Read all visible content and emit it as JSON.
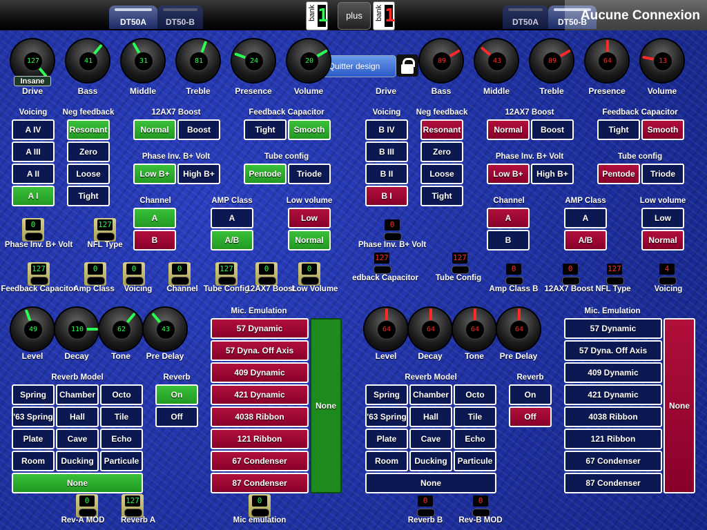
{
  "topbar": {
    "tab_a_left": "DT50A",
    "tab_b_left": "DT50-B",
    "bank_label": "bank",
    "bank_a": "1",
    "plus": "plus",
    "bank_b": "1",
    "tab_a_right": "DT50A",
    "tab_b_right": "DT50-B",
    "status": "Aucune Connexion"
  },
  "design": {
    "quit": "Quitter design"
  },
  "colors": {
    "green": "#34b934",
    "red": "#a8103a",
    "navy": "#0c1852",
    "digit_green": "#2aff55",
    "digit_red": "#ff2a2a"
  },
  "left": {
    "knobs": [
      {
        "label": "Drive",
        "value": "127"
      },
      {
        "label": "Bass",
        "value": "41"
      },
      {
        "label": "Middle",
        "value": "31"
      },
      {
        "label": "Treble",
        "value": "81"
      },
      {
        "label": "Presence",
        "value": "24"
      },
      {
        "label": "Volume",
        "value": "20"
      }
    ],
    "insane": "Insane",
    "voicing": {
      "header": "Voicing",
      "items": [
        "A IV",
        "A III",
        "A II",
        "A I"
      ]
    },
    "negfb": {
      "header": "Neg feedback",
      "items": [
        "Resonant",
        "Zero",
        "Loose",
        "Tight"
      ]
    },
    "boost": {
      "header": "12AX7 Boost",
      "items": [
        "Normal",
        "Boost"
      ]
    },
    "fbcap": {
      "header": "Feedback Capacitor",
      "items": [
        "Tight",
        "Smooth"
      ]
    },
    "phase": {
      "header": "Phase Inv. B+ Volt",
      "items": [
        "Low B+",
        "High B+"
      ]
    },
    "tube": {
      "header": "Tube config",
      "items": [
        "Pentode",
        "Triode"
      ]
    },
    "channel": {
      "header": "Channel",
      "items": [
        "A",
        "B"
      ]
    },
    "ampclass": {
      "header": "AMP Class",
      "items": [
        "A",
        "A/B"
      ]
    },
    "lowvol": {
      "header": "Low volume",
      "items": [
        "Low",
        "Normal"
      ]
    },
    "selectors1": [
      {
        "label": "Phase Inv. B+ Volt",
        "value": "0"
      },
      {
        "label": "NFL Type",
        "value": "127"
      }
    ],
    "selectors2": [
      {
        "label": "Feedback Capacitor",
        "value": "127"
      },
      {
        "label": "Amp Class",
        "value": "0"
      },
      {
        "label": "Voicing",
        "value": "0"
      },
      {
        "label": "Channel",
        "value": "0"
      },
      {
        "label": "Tube Config",
        "value": "127"
      },
      {
        "label": "12AX7 Boost",
        "value": "0"
      },
      {
        "label": "Low Volume",
        "value": "0"
      }
    ],
    "reverb_knobs": [
      {
        "label": "Level",
        "value": "49"
      },
      {
        "label": "Decay",
        "value": "110"
      },
      {
        "label": "Tone",
        "value": "62"
      },
      {
        "label": "Pre Delay",
        "value": "43"
      }
    ],
    "reverb_model": {
      "header": "Reverb Model",
      "items": [
        "Spring",
        "Chamber",
        "Octo",
        "'63 Spring",
        "Hall",
        "Tile",
        "Plate",
        "Cave",
        "Echo",
        "Room",
        "Ducking",
        "Particule"
      ],
      "none": "None"
    },
    "reverb": {
      "header": "Reverb",
      "on": "On",
      "off": "Off"
    },
    "mic": {
      "header": "Mic. Emulation",
      "items": [
        "57 Dynamic",
        "57 Dyna. Off Axis",
        "409 Dynamic",
        "421 Dynamic",
        "4038 Ribbon",
        "121 Ribbon",
        "67 Condenser",
        "87 Condenser"
      ],
      "none": "None"
    },
    "bottom_selectors": [
      {
        "label": "Rev-A MOD",
        "value": "0"
      },
      {
        "label": "Reverb A",
        "value": "127"
      },
      {
        "label": "Mic emulation",
        "value": "0"
      }
    ]
  },
  "right": {
    "knobs": [
      {
        "label": "Drive",
        "value": ""
      },
      {
        "label": "Bass",
        "value": "89"
      },
      {
        "label": "Middle",
        "value": "43"
      },
      {
        "label": "Treble",
        "value": "89"
      },
      {
        "label": "Presence",
        "value": "64"
      },
      {
        "label": "Volume",
        "value": "13"
      }
    ],
    "voicing": {
      "header": "Voicing",
      "items": [
        "B IV",
        "B III",
        "B II",
        "B I"
      ]
    },
    "negfb": {
      "header": "Neg feedback",
      "items": [
        "Resonant",
        "Zero",
        "Loose",
        "Tight"
      ]
    },
    "boost": {
      "header": "12AX7 Boost",
      "items": [
        "Normal",
        "Boost"
      ]
    },
    "fbcap": {
      "header": "Feedback Capacitor",
      "items": [
        "Tight",
        "Smooth"
      ]
    },
    "phase": {
      "header": "Phase Inv. B+ Volt",
      "items": [
        "Low B+",
        "High B+"
      ]
    },
    "tube": {
      "header": "Tube config",
      "items": [
        "Pentode",
        "Triode"
      ]
    },
    "channel": {
      "header": "Channel",
      "items": [
        "A",
        "B"
      ]
    },
    "ampclass": {
      "header": "AMP Class",
      "items": [
        "A",
        "A/B"
      ]
    },
    "lowvol": {
      "header": "Low volume",
      "items": [
        "Low",
        "Normal"
      ]
    },
    "selectors1": [
      {
        "label": "Phase Inv. B+ Volt",
        "value": "0"
      }
    ],
    "selectors2": [
      {
        "label": "edback Capacitor",
        "value": "127"
      },
      {
        "label": "Tube Config",
        "value": "127"
      },
      {
        "label": "Amp Class B",
        "value": "0"
      },
      {
        "label": "12AX7 Boost",
        "value": "0"
      },
      {
        "label": "NFL Type",
        "value": "127"
      },
      {
        "label": "Voicing",
        "value": "4"
      }
    ],
    "reverb_knobs": [
      {
        "label": "Level",
        "value": "64"
      },
      {
        "label": "Decay",
        "value": "64"
      },
      {
        "label": "Tone",
        "value": "64"
      },
      {
        "label": "Pre Delay",
        "value": "64"
      }
    ],
    "reverb_model": {
      "header": "Reverb Model",
      "items": [
        "Spring",
        "Chamber",
        "Octo",
        "'63 Spring",
        "Hall",
        "Tile",
        "Plate",
        "Cave",
        "Echo",
        "Room",
        "Ducking",
        "Particule"
      ],
      "none": "None"
    },
    "reverb": {
      "header": "Reverb",
      "on": "On",
      "off": "Off"
    },
    "mic": {
      "header": "Mic. Emulation",
      "items": [
        "57 Dynamic",
        "57 Dyna. Off Axis",
        "409 Dynamic",
        "421 Dynamic",
        "4038 Ribbon",
        "121 Ribbon",
        "67 Condenser",
        "87 Condenser"
      ],
      "none": "None"
    },
    "bottom_selectors": [
      {
        "label": "Reverb B",
        "value": "0"
      },
      {
        "label": "Rev-B MOD",
        "value": "0"
      }
    ]
  }
}
